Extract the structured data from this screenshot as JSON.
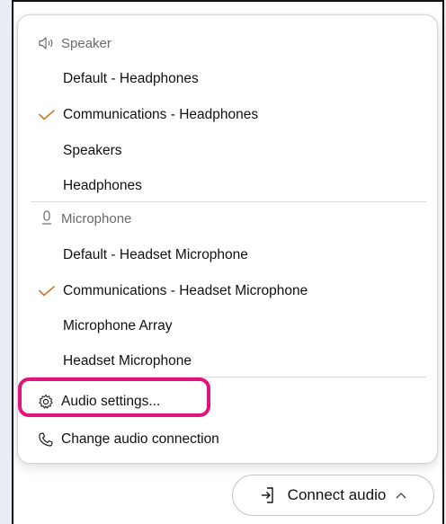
{
  "speaker": {
    "header": "Speaker",
    "icon": "speaker-icon",
    "items": [
      {
        "label": "Default - Headphones",
        "selected": false
      },
      {
        "label": "Communications - Headphones",
        "selected": true
      },
      {
        "label": "Speakers",
        "selected": false
      },
      {
        "label": "Headphones",
        "selected": false
      }
    ]
  },
  "microphone": {
    "header": "Microphone",
    "icon": "microphone-icon",
    "items": [
      {
        "label": "Default - Headset Microphone",
        "selected": false
      },
      {
        "label": "Communications - Headset Microphone",
        "selected": true
      },
      {
        "label": "Microphone Array",
        "selected": false
      },
      {
        "label": "Headset Microphone",
        "selected": false
      }
    ]
  },
  "actions": {
    "audio_settings": {
      "label": "Audio settings...",
      "icon": "gear-icon"
    },
    "change_connection": {
      "label": "Change audio connection",
      "icon": "phone-icon"
    }
  },
  "connect_button": {
    "label": "Connect audio",
    "icon": "connect-audio-icon",
    "chevron": "chevron-up-icon"
  },
  "colors": {
    "check": "#c8782c",
    "highlight": "#e0147d"
  }
}
